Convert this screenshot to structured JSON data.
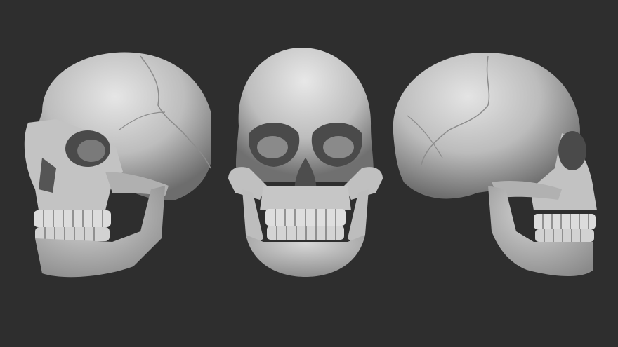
{
  "scene": {
    "background_color": "#2e2e2e",
    "material_color": "#c9c9c9",
    "shadow_color": "#5a5a5a",
    "views": [
      {
        "name": "three-quarter-left",
        "icon": "skull-icon"
      },
      {
        "name": "front",
        "icon": "skull-icon"
      },
      {
        "name": "three-quarter-right",
        "icon": "skull-icon"
      }
    ]
  }
}
